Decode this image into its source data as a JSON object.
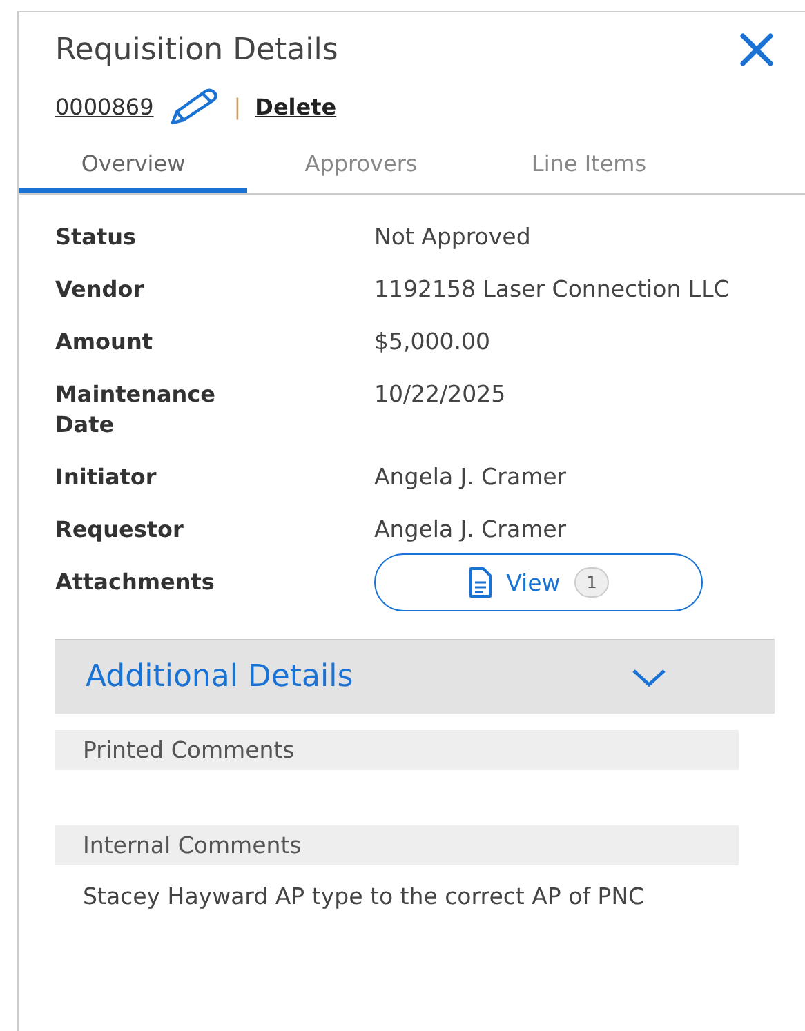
{
  "panel": {
    "title": "Requisition Details",
    "number": "0000869",
    "separator": "|",
    "delete_link": "Delete"
  },
  "tabs": [
    {
      "label": "Overview",
      "selected": true
    },
    {
      "label": "Approvers",
      "selected": false
    },
    {
      "label": "Line Items",
      "selected": false
    }
  ],
  "fields": [
    {
      "label": "Status",
      "value": "Not Approved"
    },
    {
      "label": "Vendor",
      "value": "1192158 Laser Connection LLC"
    },
    {
      "label": "Amount",
      "value": "$5,000.00"
    },
    {
      "label": "Maintenance Date",
      "value": "10/22/2025"
    },
    {
      "label": "Initiator",
      "value": "Angela J. Cramer"
    },
    {
      "label": "Requestor",
      "value": "Angela J. Cramer"
    }
  ],
  "attachments": {
    "label": "Attachments",
    "button": "View",
    "count": "1"
  },
  "additional_details": {
    "title": "Additional Details",
    "expanded": false,
    "sections": [
      {
        "heading": "Printed Comments"
      },
      {
        "heading": "Internal Comments",
        "text": "Stacey Hayward AP type to the correct AP of PNC"
      }
    ]
  }
}
